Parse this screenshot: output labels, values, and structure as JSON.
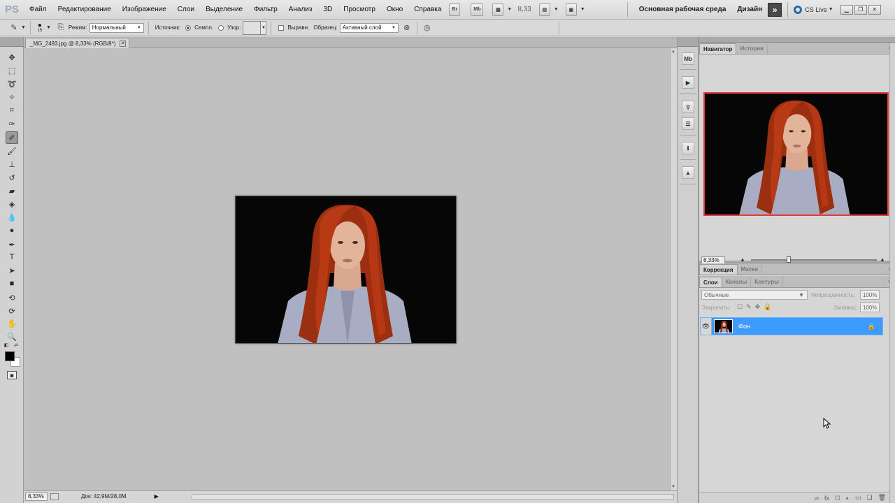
{
  "app": {
    "logo": "PS"
  },
  "menubar": {
    "items": [
      "Файл",
      "Редактирование",
      "Изображение",
      "Слои",
      "Выделение",
      "Фильтр",
      "Анализ",
      "3D",
      "Просмотр",
      "Окно",
      "Справка"
    ],
    "bridge_label": "Br",
    "minibridge_label": "Mb",
    "zoom": "8,33",
    "workspace": "Основная рабочая среда",
    "design": "Дизайн",
    "expand": "»",
    "cslive": "CS Live"
  },
  "options": {
    "brush_size": "15",
    "mode_label": "Режим:",
    "mode_value": "Нормальный",
    "source_label": "Источник:",
    "sampled_label": "Семпл.",
    "pattern_label": "Узор:",
    "aligned_label": "Выравн.",
    "sample_label": "Образец:",
    "sample_value": "Активный слой"
  },
  "document": {
    "tab_title": "_MG_2493.jpg @ 8,33% (RGB/8*)",
    "close_icon": "close-icon"
  },
  "statusbar": {
    "zoom": "8,33%",
    "doc_info": "Док: 42,9M/28,0M",
    "arrow": "▶"
  },
  "navigator": {
    "tabs": [
      "Навигатор",
      "История"
    ],
    "zoom": "8,33%"
  },
  "adjustments": {
    "tabs": [
      "Коррекция",
      "Маски"
    ]
  },
  "layers": {
    "tabs": [
      "Слои",
      "Каналы",
      "Контуры"
    ],
    "blend_mode": "Обычные",
    "opacity_label": "Непрозрачность:",
    "opacity": "100%",
    "lock_label": "Закрепить:",
    "fill_label": "Заливка:",
    "fill": "100%",
    "items": [
      {
        "name": "Фон",
        "visible": true,
        "locked": true,
        "selected": true
      }
    ]
  },
  "colors": {
    "selection": "#3d9aff",
    "nav_frame": "#e03a3a",
    "foreground": "#000000",
    "background": "#ffffff"
  }
}
